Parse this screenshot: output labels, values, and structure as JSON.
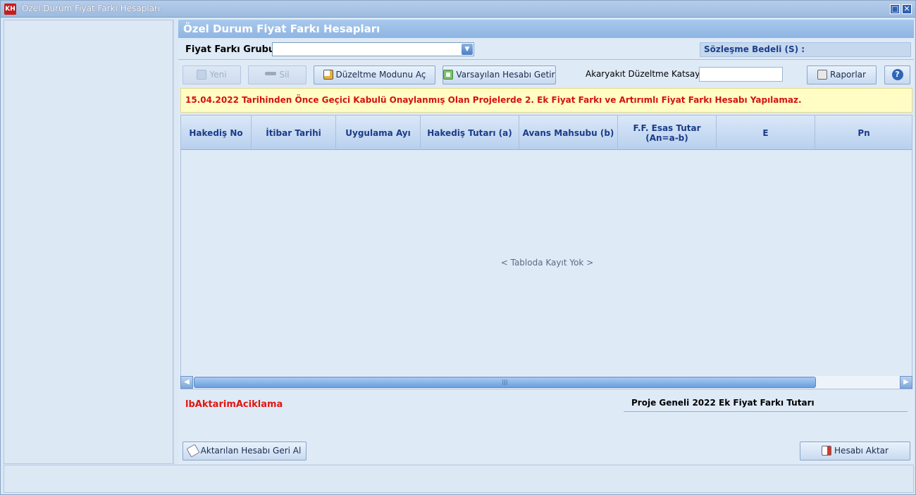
{
  "window": {
    "title": "Özel Durum Fiyat Farkı Hesapları",
    "app_icon_text": "KH",
    "maximize_glyph": "□",
    "close_glyph": "✕"
  },
  "main": {
    "header": "Özel Durum Fiyat Farkı Hesapları",
    "fiyat_farki_grubu_label": "Fiyat Farkı Grubu :",
    "fiyat_farki_grubu_value": "",
    "sozlesme_bedeli_label": "Sözleşme Bedeli (S) :"
  },
  "toolbar": {
    "yeni_label": "Yeni",
    "sil_label": "Sil",
    "duzeltme_label": "Düzeltme Modunu Aç",
    "varsayilan_label": "Varsayılan Hesabı Getir",
    "akaryakit_label": "Akaryakıt Düzeltme Katsayısı",
    "akaryakit_value": "",
    "raporlar_label": "Raporlar",
    "help_glyph": "?"
  },
  "warning": "15.04.2022 Tarihinden Önce Geçici Kabulü Onaylanmış Olan Projelerde 2. Ek Fiyat Farkı ve Artırımlı Fiyat Farkı Hesabı Yapılamaz.",
  "grid": {
    "columns": [
      "Hakediş No",
      "İtibar Tarihi",
      "Uygulama Ayı",
      "Hakediş Tutarı (a)",
      "Avans Mahsubu (b)",
      "F.F. Esas Tutar\n(An=a-b)",
      "E",
      "Pn"
    ],
    "empty_message": "< Tabloda Kayıt Yok >"
  },
  "footer": {
    "ib_aktarim_label": "lbAktarimAciklama",
    "proje_geneli_label": "Proje Geneli 2022 Ek Fiyat Farkı Tutarı",
    "geri_al_label": "Aktarılan Hesabı Geri Al",
    "aktar_label": "Hesabı Aktar"
  },
  "colors": {
    "warning_text": "#d6120f",
    "warning_bg": "#fffdc4",
    "header_blue": "#8fb5e3",
    "grid_header_text": "#1a3b88"
  }
}
